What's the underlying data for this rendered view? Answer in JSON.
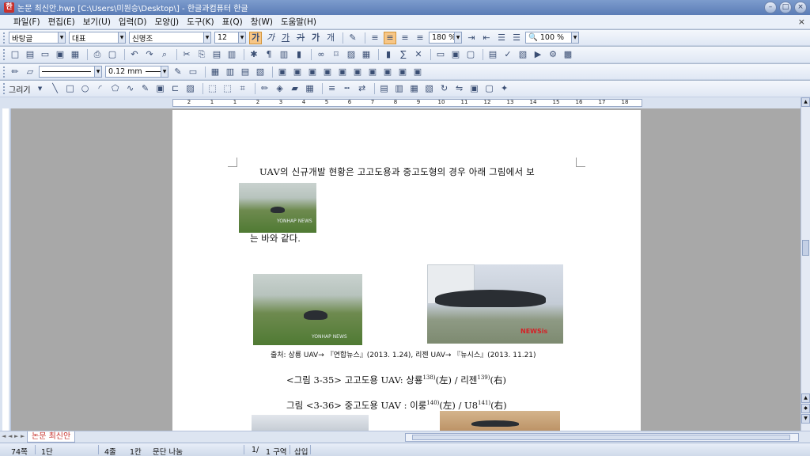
{
  "window": {
    "title": "논문 최신안.hwp [C:\\Users\\미원승\\Desktop\\] - 한글과컴퓨터 한글",
    "app_icon": "한",
    "controls": [
      "minimize-icon",
      "maximize-icon",
      "close-icon"
    ]
  },
  "menu": {
    "items": [
      "파일(F)",
      "편집(E)",
      "보기(U)",
      "입력(D)",
      "모양(J)",
      "도구(K)",
      "표(Q)",
      "창(W)",
      "도움말(H)"
    ],
    "close_glyph": "×"
  },
  "format_toolbar": {
    "style": "바탕글",
    "font_lang": "대표",
    "font_name": "신명조",
    "font_size": "12",
    "bold_glyph": "가",
    "italic_glyph": "가",
    "underline_glyph": "가",
    "strike_glyph": "가",
    "outline_glyph": "가",
    "char_glyph": "개",
    "line_spacing": "180 %",
    "zoom": "100 %"
  },
  "draw_toolbar": {
    "line_width": "0.12 mm",
    "draw_label": "그리기"
  },
  "ruler": {
    "labels": [
      "2",
      "1",
      "1",
      "2",
      "3",
      "4",
      "5",
      "6",
      "7",
      "8",
      "9",
      "10",
      "11",
      "12",
      "13",
      "14",
      "15",
      "16",
      "17",
      "18"
    ]
  },
  "document": {
    "para1_line1": "UAV의 신규개발 현황은 고고도용과 중고도형의 경우 아래 그림에서 보",
    "para1_line2": "는 바와 같다.",
    "source_line": "출처: 상룡 UAV→ 『연합뉴스』(2013. 1.24), 리젠 UAV→ 『뉴시스』(2013. 11.21)",
    "caption1": "<그림 3-35> 고고도용 UAV: 상룡",
    "caption1_sup1": "138)",
    "caption1_mid": "(左) / 리젠",
    "caption1_sup2": "139)",
    "caption1_end": "(右)",
    "caption2": "그림 <3-36> 중고도용 UAV : 이룽",
    "caption2_sup1": "140)",
    "caption2_mid": "(左) / U8",
    "caption2_sup2": "141)",
    "caption2_end": "(右)",
    "watermark_yonhap": "YONHAP NEWS",
    "watermark_newsis": "NEWSis"
  },
  "tabs": {
    "active": "논문 최신안",
    "nav": [
      "◄",
      "◄",
      "►",
      "►"
    ]
  },
  "status": {
    "page": "74쪽",
    "section": "1단",
    "line": "4줄",
    "column": "1칸",
    "paragraph_break": "문단 나눔",
    "pages": "1/",
    "block": "1 구역",
    "mode": "삽입"
  },
  "colors": {
    "title_bar": "#5a7cb6",
    "tab_text": "#c62f2a",
    "active_button": "#f7c686"
  }
}
